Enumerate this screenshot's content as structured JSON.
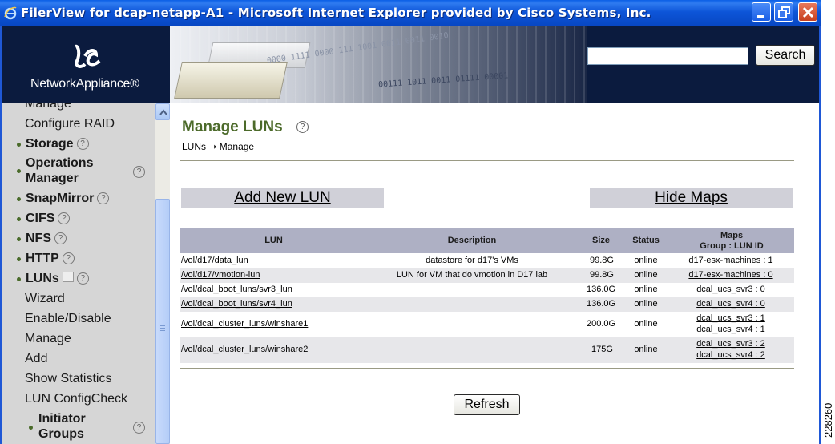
{
  "window": {
    "title": "FilerView for dcap-netapp-A1 - Microsoft Internet Explorer provided by Cisco Systems, Inc."
  },
  "banner": {
    "logo_text": "NetworkAppliance®",
    "search_value": "",
    "search_button": "Search"
  },
  "sidebar": {
    "items": [
      {
        "label": "Manage"
      },
      {
        "label": "Configure RAID"
      },
      {
        "label": "Storage"
      },
      {
        "label": "Operations"
      },
      {
        "label": "Manager"
      },
      {
        "label": "SnapMirror"
      },
      {
        "label": "CIFS"
      },
      {
        "label": "NFS"
      },
      {
        "label": "HTTP"
      },
      {
        "label": "LUNs"
      },
      {
        "label": "Wizard"
      },
      {
        "label": "Enable/Disable"
      },
      {
        "label": "Manage"
      },
      {
        "label": "Add"
      },
      {
        "label": "Show Statistics"
      },
      {
        "label": "LUN ConfigCheck"
      },
      {
        "label": "Initiator"
      },
      {
        "label": "Groups"
      }
    ],
    "help_glyph": "?"
  },
  "main": {
    "title": "Manage LUNs",
    "breadcrumb": "LUNs ➝ Manage",
    "add_new_lun": "Add New LUN",
    "hide_maps": "Hide Maps",
    "refresh": "Refresh",
    "columns": {
      "lun": "LUN",
      "description": "Description",
      "size": "Size",
      "status": "Status",
      "maps_1": "Maps",
      "maps_2": "Group : LUN ID"
    },
    "rows": [
      {
        "lun": "/vol/d17/data_lun",
        "description": "datastore for d17's VMs",
        "size": "99.8G",
        "status": "online",
        "maps": [
          "d17-esx-machines : 1"
        ]
      },
      {
        "lun": "/vol/d17/vmotion-lun",
        "description": "LUN for VM that do vmotion in D17 lab",
        "size": "99.8G",
        "status": "online",
        "maps": [
          "d17-esx-machines : 0"
        ]
      },
      {
        "lun": "/vol/dcal_boot_luns/svr3_lun",
        "description": "",
        "size": "136.0G",
        "status": "online",
        "maps": [
          "dcal_ucs_svr3 : 0"
        ]
      },
      {
        "lun": "/vol/dcal_boot_luns/svr4_lun",
        "description": "",
        "size": "136.0G",
        "status": "online",
        "maps": [
          "dcal_ucs_svr4 : 0"
        ]
      },
      {
        "lun": "/vol/dcal_cluster_luns/winshare1",
        "description": "",
        "size": "200.0G",
        "status": "online",
        "maps": [
          "dcal_ucs_svr3 : 1",
          "dcal_ucs_svr4 : 1"
        ]
      },
      {
        "lun": "/vol/dcal_cluster_luns/winshare2",
        "description": "",
        "size": "175G",
        "status": "online",
        "maps": [
          "dcal_ucs_svr3 : 2",
          "dcal_ucs_svr4 : 2"
        ]
      }
    ]
  },
  "figure_id": "228260"
}
